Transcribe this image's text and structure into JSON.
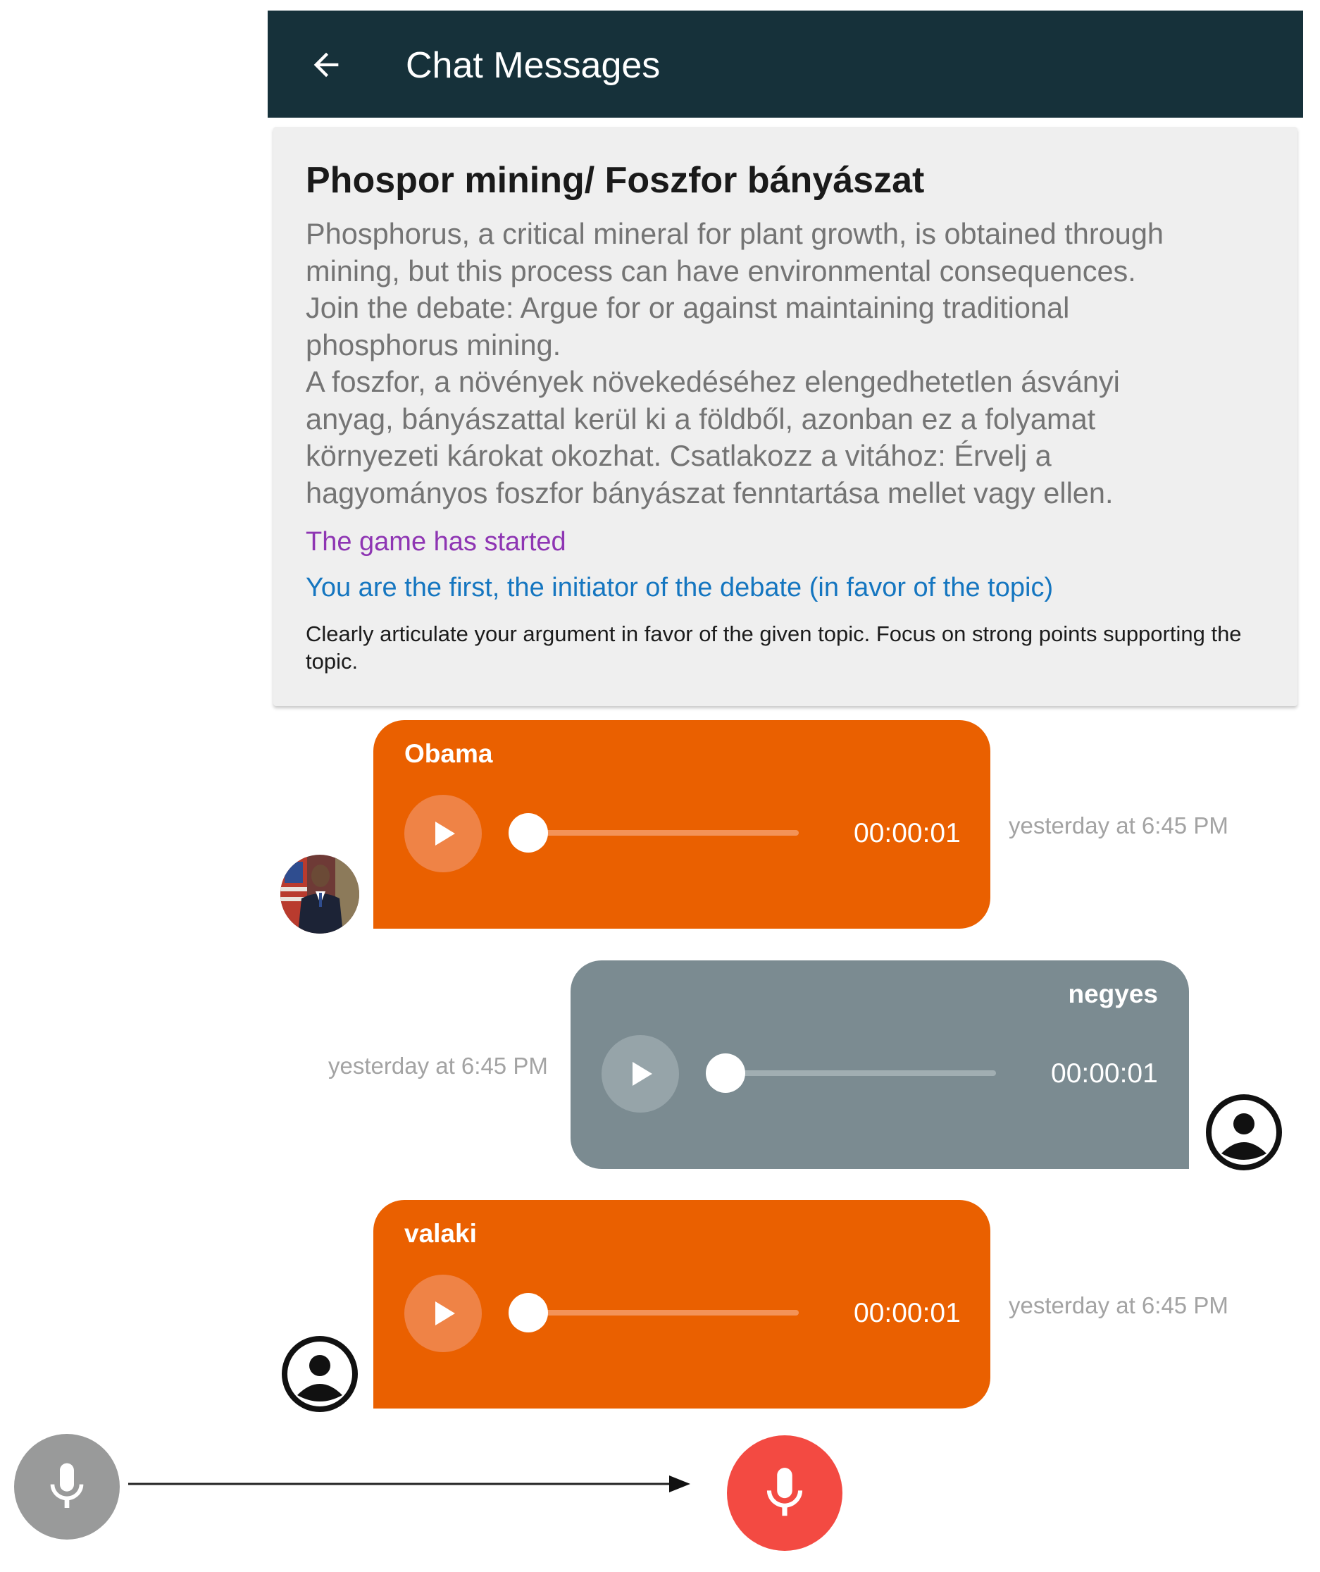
{
  "header": {
    "title": "Chat Messages",
    "back_icon": "arrow-left-icon",
    "background": "#16313a"
  },
  "topic": {
    "title": "Phospor mining/ Foszfor bányászat",
    "description_lines": [
      "Phosphorus, a critical mineral for plant growth, is obtained through",
      "mining, but this process can have environmental consequences.",
      "Join the debate: Argue for or against maintaining traditional",
      "phosphorus mining.",
      "A foszfor, a növények növekedéséhez elengedhetetlen ásványi",
      "anyag, bányászattal kerül ki a földből, azonban ez a folyamat",
      "környezeti károkat okozhat. Csatlakozz a vitához: Érvelj a",
      "hagyományos foszfor bányászat fenntartása mellet vagy ellen."
    ],
    "status_started": "The game has started",
    "status_role": "You are the first, the initiator of the debate (in favor of the topic)",
    "instructions": "Clearly articulate your argument in favor of the given topic. Focus on strong points supporting the topic."
  },
  "messages": [
    {
      "sender": "Obama",
      "duration": "00:00:01",
      "timestamp": "yesterday at 6:45 PM",
      "side": "left",
      "avatar": "photo-avatar",
      "progress": 0
    },
    {
      "sender": "negyes",
      "duration": "00:00:01",
      "timestamp": "yesterday at 6:45 PM",
      "side": "right",
      "avatar": "account-circle-icon",
      "progress": 0
    },
    {
      "sender": "valaki",
      "duration": "00:00:01",
      "timestamp": "yesterday at 6:45 PM",
      "side": "left",
      "avatar": "account-circle-icon",
      "progress": 0
    }
  ],
  "controls": {
    "mic_idle_icon": "microphone-icon",
    "mic_recording_icon": "microphone-icon",
    "transition_icon": "arrow-right-icon"
  },
  "colors": {
    "own_bubble": "#ea6000",
    "other_bubble": "#7b8b91",
    "status_started": "#8e35b3",
    "status_role": "#1576c0",
    "mic_idle": "#999a9a",
    "mic_recording": "#f34a42"
  }
}
